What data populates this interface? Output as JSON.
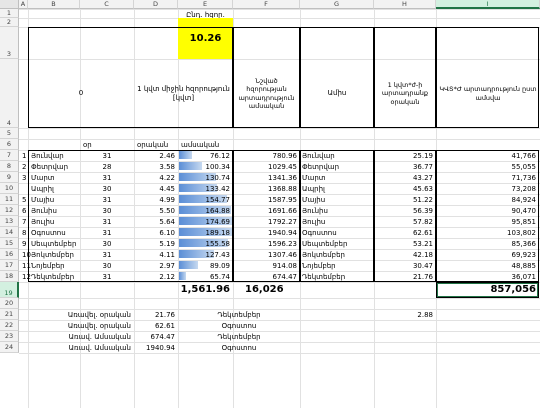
{
  "columns": [
    "A",
    "B",
    "C",
    "D",
    "E",
    "F",
    "G",
    "H",
    "I"
  ],
  "rows": [
    "1",
    "2",
    "3",
    "4",
    "5",
    "6",
    "7",
    "8",
    "9",
    "10",
    "11",
    "12",
    "13",
    "14",
    "15",
    "16",
    "17",
    "18",
    "19",
    "20",
    "21",
    "22",
    "23",
    "24"
  ],
  "title": "Ընդ. հզոր.",
  "highlight_value": "10.26",
  "headers": {
    "b": "0",
    "d": "1 կվտ միջին հզորություն [կվտ]",
    "f": "Նշված հզորության արտադրություն ամսական",
    "g": "Ամիս",
    "h": "1 կվտ*ժ-ի արտադրանք օրական",
    "i": "ԿՎՏ*Ժ արտադրություն ըստ ամսվա"
  },
  "subheaders": {
    "c": "օր",
    "d": "օրական",
    "e": "ամսական"
  },
  "months": [
    {
      "n": "1",
      "m": "Յունվար",
      "days": "31",
      "daily": "2.46",
      "monthly": "76.12",
      "bar": 0.24,
      "prod": "780.96",
      "m2": "Յունվար",
      "h": "25.19",
      "i": "41,766"
    },
    {
      "n": "2",
      "m": "Փետրվար",
      "days": "28",
      "daily": "3.58",
      "monthly": "100.34",
      "bar": 0.44,
      "prod": "1029.45",
      "m2": "Փետրվար",
      "h": "36.77",
      "i": "55,055"
    },
    {
      "n": "3",
      "m": "Մարտ",
      "days": "31",
      "daily": "4.22",
      "monthly": "130.74",
      "bar": 0.7,
      "prod": "1341.36",
      "m2": "Մարտ",
      "h": "43.27",
      "i": "71,736"
    },
    {
      "n": "",
      "m": "Ապրիլ",
      "days": "30",
      "daily": "4.45",
      "monthly": "133.42",
      "bar": 0.72,
      "prod": "1368.88",
      "m2": "Ապրիլ",
      "h": "45.63",
      "i": "73,208"
    },
    {
      "n": "5",
      "m": "Մայիս",
      "days": "31",
      "daily": "4.99",
      "monthly": "154.77",
      "bar": 0.9,
      "prod": "1587.95",
      "m2": "Մայիս",
      "h": "51.22",
      "i": "84,924"
    },
    {
      "n": "6",
      "m": "Յունիս",
      "days": "30",
      "daily": "5.50",
      "monthly": "164.88",
      "bar": 0.98,
      "prod": "1691.66",
      "m2": "Յունիս",
      "h": "56.39",
      "i": "90,470"
    },
    {
      "n": "7",
      "m": "Յուլիս",
      "days": "31",
      "daily": "5.64",
      "monthly": "174.69",
      "bar": 1.0,
      "prod": "1792.27",
      "m2": "Յուլիս",
      "h": "57.82",
      "i": "95,851"
    },
    {
      "n": "8",
      "m": "Օգոստոս",
      "days": "31",
      "daily": "6.10",
      "monthly": "189.18",
      "bar": 1.0,
      "prod": "1940.94",
      "m2": "Օգոստոս",
      "h": "62.61",
      "i": "103,802"
    },
    {
      "n": "9",
      "m": "Սեպտեմբեր",
      "days": "30",
      "daily": "5.19",
      "monthly": "155.58",
      "bar": 0.92,
      "prod": "1596.23",
      "m2": "Սեպտեմբեր",
      "h": "53.21",
      "i": "85,366"
    },
    {
      "n": "10",
      "m": "Յոկտեմբեր",
      "days": "31",
      "daily": "4.11",
      "monthly": "127.43",
      "bar": 0.66,
      "prod": "1307.46",
      "m2": "Յոկտեմբեր",
      "h": "42.18",
      "i": "69,923"
    },
    {
      "n": "11",
      "m": "Նոյեմբեր",
      "days": "30",
      "daily": "2.97",
      "monthly": "89.09",
      "bar": 0.36,
      "prod": "914.08",
      "m2": "Նոյեմբեր",
      "h": "30.47",
      "i": "48,885"
    },
    {
      "n": "12",
      "m": "Դեկտեմբեր",
      "days": "31",
      "daily": "2.12",
      "monthly": "65.74",
      "bar": 0.14,
      "prod": "674.47",
      "m2": "Դեկտեմբեր",
      "h": "21.76",
      "i": "36,071"
    }
  ],
  "totals": {
    "e": "1,561.96",
    "f": "16,026",
    "i": "857,056"
  },
  "stats": [
    {
      "label": "Առավել. օրական",
      "value": "21.76",
      "month": "Դեկտեմբեր",
      "extra": "2.88"
    },
    {
      "label": "Առավել. օրական",
      "value": "62.61",
      "month": "Օգոստոս",
      "extra": ""
    },
    {
      "label": "Առավ. Ամսական",
      "value": "674.47",
      "month": "Դեկտեմբեր",
      "extra": ""
    },
    {
      "label": "Առավ. Ամսական",
      "value": "1940.94",
      "month": "Օգոստոս",
      "extra": ""
    }
  ],
  "colors": {
    "highlight": "#ffff00",
    "bar": "#5b8ed6",
    "selection": "#217346"
  }
}
